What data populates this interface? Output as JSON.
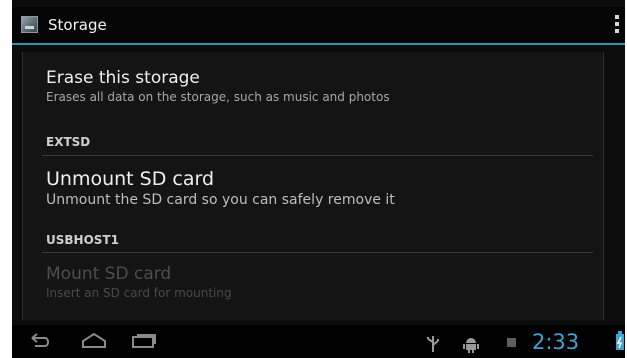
{
  "action_bar": {
    "title": "Storage",
    "app_icon": "storage-icon",
    "overflow_icon": "overflow-menu-icon"
  },
  "items": [
    {
      "title": "Erase this storage",
      "summary": "Erases all data on the storage, such as music and photos",
      "enabled": true
    },
    {
      "category": "EXTSD"
    },
    {
      "title": "Unmount SD card",
      "summary": "Unmount the SD card so you can safely remove it",
      "enabled": true
    },
    {
      "category": "USBHOST1"
    },
    {
      "title": "Mount SD card",
      "summary": "Insert an SD card for mounting",
      "enabled": false
    }
  ],
  "nav_bar": {
    "buttons": [
      "back-icon",
      "home-icon",
      "recent-apps-icon"
    ],
    "status_icons": [
      "usb-icon",
      "android-debug-icon",
      "notification-icon",
      "battery-icon"
    ],
    "clock": "2:33"
  },
  "colors": {
    "accent": "#2d93b7",
    "clock": "#3aa6d6",
    "background": "#0c0c0c"
  }
}
